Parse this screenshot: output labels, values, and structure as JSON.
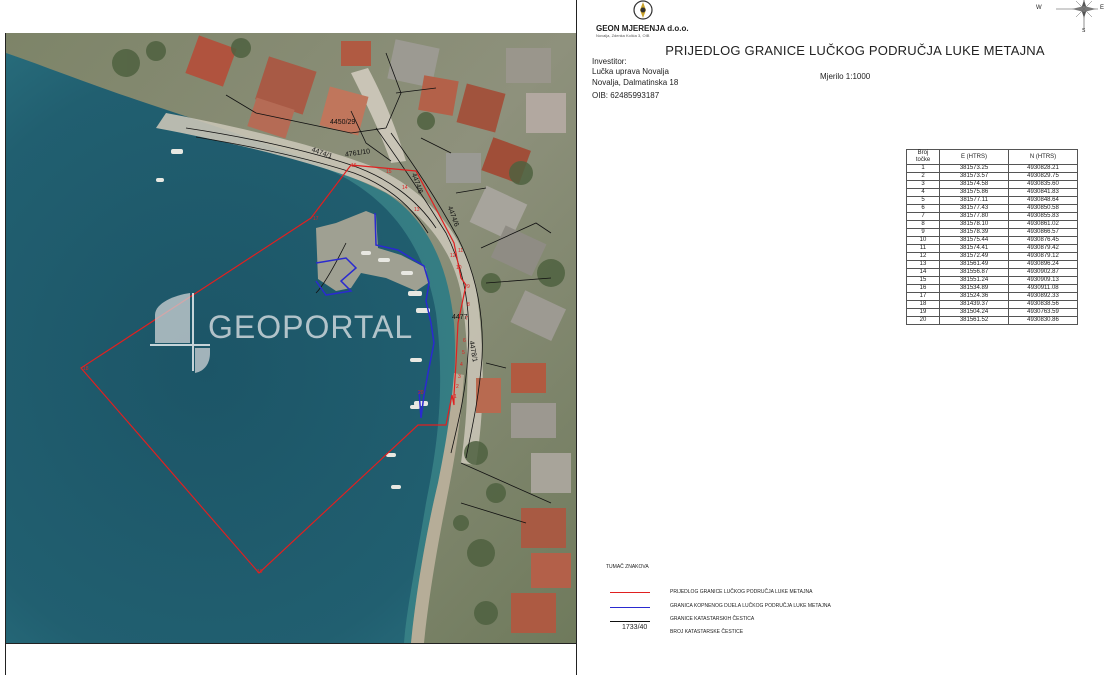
{
  "company": {
    "name": "GEON MJERENJA d.o.o.",
    "subline": "Novalja, Zdenka Kolića 3, OIB"
  },
  "title": "PRIJEDLOG GRANICE LUČKOG PODRUČJA LUKE METAJNA",
  "investor": {
    "heading": "Investitor:",
    "name": "Lučka uprava Novalja",
    "address": "Novalja, Dalmatinska 18",
    "oib": "OIB: 62485993187"
  },
  "scale": "Mjerilo 1:1000",
  "compass": {
    "w": "W",
    "e": "E",
    "n": "N",
    "s": "S"
  },
  "watermark": "GEOPORTAL",
  "parcels": [
    "4450/29",
    "4761/10",
    "4474/1",
    "4474/6",
    "4474/6",
    "4477",
    "4478/1"
  ],
  "map_points": [
    "1",
    "2",
    "3",
    "4",
    "5",
    "6",
    "7",
    "8",
    "9",
    "10",
    "11",
    "12",
    "13",
    "14",
    "15",
    "16",
    "17",
    "18",
    "19",
    "20"
  ],
  "table": {
    "headers": [
      "Broj točke",
      "E (HTRS)",
      "N (HTRS)"
    ],
    "rows": [
      [
        "1",
        "381573.25",
        "4930828.21"
      ],
      [
        "2",
        "381573.57",
        "4930829.75"
      ],
      [
        "3",
        "381574.58",
        "4930835.60"
      ],
      [
        "4",
        "381575.86",
        "4930841.83"
      ],
      [
        "5",
        "381577.11",
        "4930848.64"
      ],
      [
        "6",
        "381577.43",
        "4930850.58"
      ],
      [
        "7",
        "381577.80",
        "4930855.83"
      ],
      [
        "8",
        "381578.10",
        "4930861.02"
      ],
      [
        "9",
        "381578.39",
        "4930866.57"
      ],
      [
        "10",
        "381575.44",
        "4930876.45"
      ],
      [
        "11",
        "381574.41",
        "4930879.42"
      ],
      [
        "12",
        "381572.49",
        "4930879.12"
      ],
      [
        "13",
        "381561.49",
        "4930896.24"
      ],
      [
        "14",
        "381556.87",
        "4930902.87"
      ],
      [
        "15",
        "381551.24",
        "4930909.13"
      ],
      [
        "16",
        "381534.89",
        "4930911.08"
      ],
      [
        "17",
        "381524.36",
        "4930892.33"
      ],
      [
        "18",
        "381439.37",
        "4930838.56"
      ],
      [
        "19",
        "381504.24",
        "4930763.59"
      ],
      [
        "20",
        "381561.52",
        "4930830.86"
      ]
    ]
  },
  "legend": {
    "title": "TUMAČ ZNAKOVA",
    "items": [
      "PRIJEDLOG GRANICE LUČKOG PODRUČJA LUKE METAJNA",
      "GRANICA KOPNENOG DIJELA LUČKOG PODRUČJA LUKE METAJNA",
      "GRANICE KATASTARSKIH ČESTICA",
      "BROJ KATASTARSKE ČESTICE"
    ],
    "sample_number": "1733/40"
  },
  "colors": {
    "port_boundary": "#e02020",
    "land_boundary": "#2a2ad0",
    "parcel_boundary": "#111111",
    "sea": "#1f5e72",
    "land": "#8a8f78"
  }
}
